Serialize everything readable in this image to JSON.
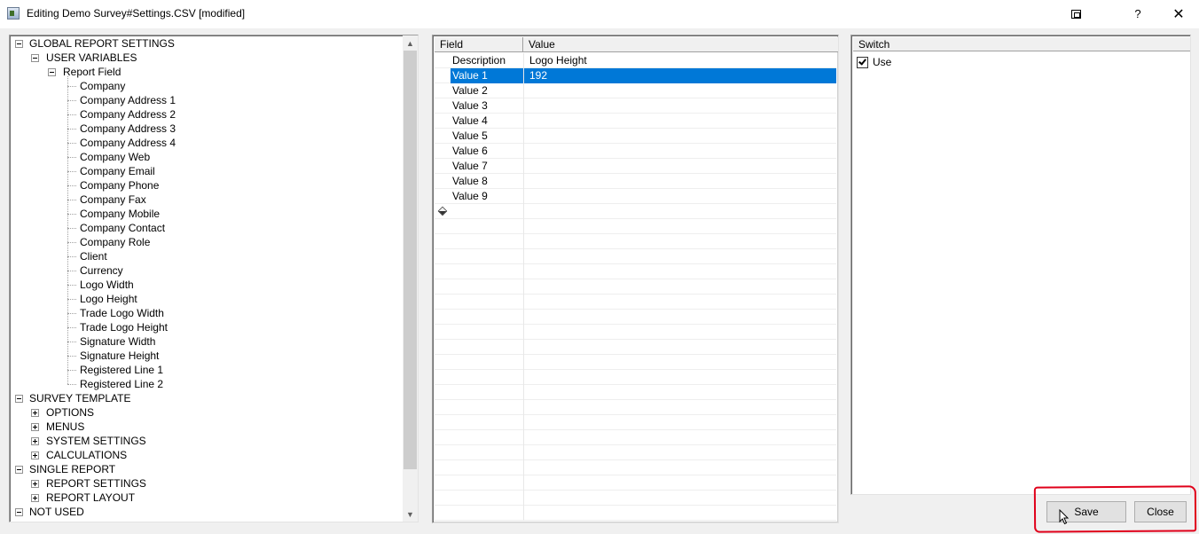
{
  "window": {
    "title": "Editing Demo Survey#Settings.CSV [modified]",
    "buttons": {
      "help": "?",
      "close": "✕"
    }
  },
  "tree": {
    "nodes": [
      {
        "label": "GLOBAL REPORT SETTINGS",
        "state": "expanded"
      },
      {
        "label": "USER VARIABLES",
        "state": "expanded"
      },
      {
        "label": "Report Field",
        "state": "expanded"
      },
      {
        "label": "Company"
      },
      {
        "label": "Company Address 1"
      },
      {
        "label": "Company Address 2"
      },
      {
        "label": "Company Address 3"
      },
      {
        "label": "Company Address 4"
      },
      {
        "label": "Company Web"
      },
      {
        "label": "Company Email"
      },
      {
        "label": "Company Phone"
      },
      {
        "label": "Company Fax"
      },
      {
        "label": "Company Mobile"
      },
      {
        "label": "Company Contact"
      },
      {
        "label": "Company Role"
      },
      {
        "label": "Client"
      },
      {
        "label": "Currency"
      },
      {
        "label": "Logo Width"
      },
      {
        "label": "Logo Height"
      },
      {
        "label": "Trade Logo Width"
      },
      {
        "label": "Trade Logo Height"
      },
      {
        "label": "Signature Width"
      },
      {
        "label": "Signature Height"
      },
      {
        "label": "Registered Line 1"
      },
      {
        "label": "Registered Line 2"
      },
      {
        "label": "SURVEY TEMPLATE",
        "state": "expanded"
      },
      {
        "label": "OPTIONS",
        "state": "collapsed"
      },
      {
        "label": "MENUS",
        "state": "collapsed"
      },
      {
        "label": "SYSTEM SETTINGS",
        "state": "collapsed"
      },
      {
        "label": "CALCULATIONS",
        "state": "collapsed"
      },
      {
        "label": "SINGLE REPORT",
        "state": "expanded"
      },
      {
        "label": "REPORT SETTINGS",
        "state": "collapsed"
      },
      {
        "label": "REPORT LAYOUT",
        "state": "collapsed"
      },
      {
        "label": "NOT USED",
        "state": "expanded"
      }
    ]
  },
  "grid": {
    "columns": [
      "Field",
      "Value"
    ],
    "rows": [
      {
        "field": "Description",
        "value": "Logo Height"
      },
      {
        "field": "Value 1",
        "value": "192",
        "selected": true
      },
      {
        "field": "Value 2",
        "value": ""
      },
      {
        "field": "Value 3",
        "value": ""
      },
      {
        "field": "Value 4",
        "value": ""
      },
      {
        "field": "Value 5",
        "value": ""
      },
      {
        "field": "Value 6",
        "value": ""
      },
      {
        "field": "Value 7",
        "value": ""
      },
      {
        "field": "Value 8",
        "value": ""
      },
      {
        "field": "Value 9",
        "value": ""
      }
    ]
  },
  "switch_panel": {
    "header": "Switch",
    "use_label": "Use",
    "use_checked": true
  },
  "actions": {
    "save_label": "Save",
    "close_label": "Close"
  },
  "colors": {
    "selection": "#0078d7",
    "annotation": "#e0001a"
  }
}
